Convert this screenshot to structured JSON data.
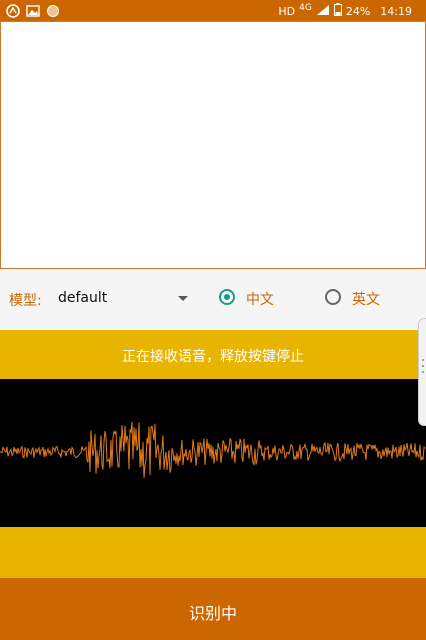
{
  "status_bar": {
    "icons_left": [
      "dashboard-app-icon",
      "image-app-icon",
      "circle-app-icon"
    ],
    "network_hd": "HD",
    "network_type": "4G",
    "battery": "24%",
    "time": "14:19"
  },
  "controls": {
    "model_label": "模型:",
    "model_value": "default",
    "lang_chinese": "中文",
    "lang_english": "英文",
    "selected_language": "中文"
  },
  "hint": {
    "text": "正在接收语音，释放按键停止"
  },
  "record_button": {
    "label": "识别中"
  },
  "colors": {
    "brand_orange": "#cc6600",
    "accent_yellow": "#e8b400",
    "radio_selected": "#1a9a8c",
    "waveform": "#e07a1a"
  }
}
